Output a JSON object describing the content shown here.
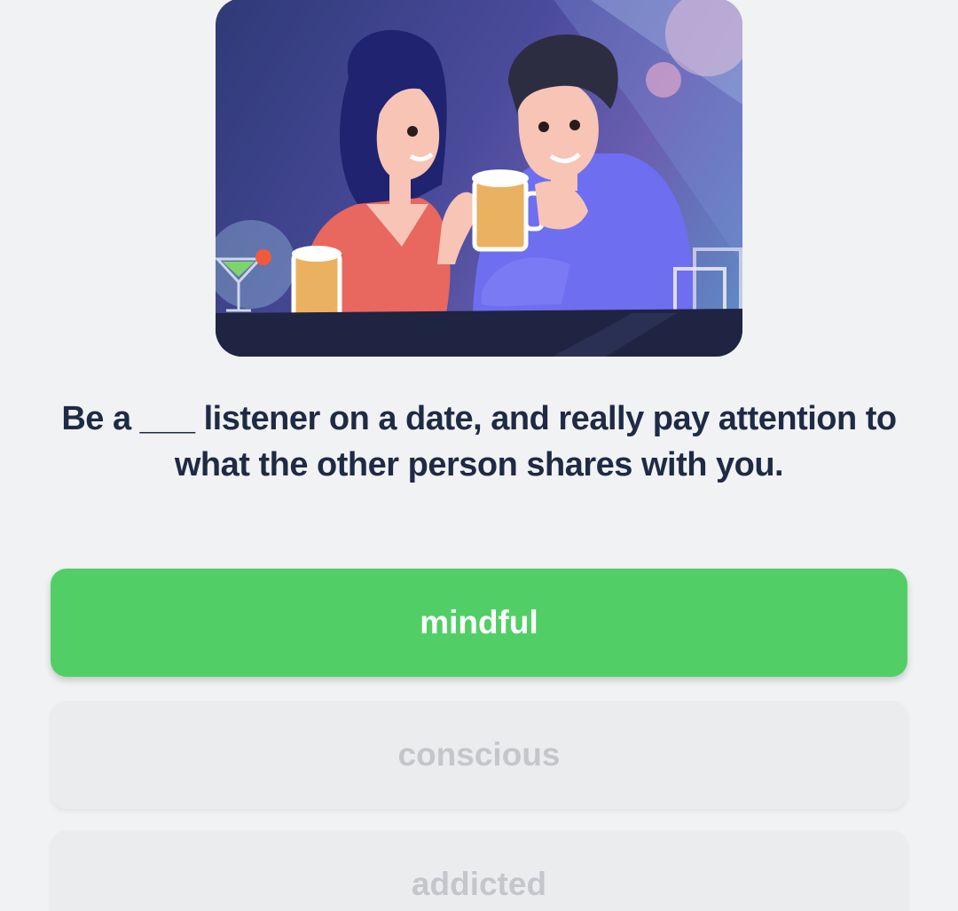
{
  "quiz": {
    "illustration": {
      "icon": "couple-at-bar-illustration"
    },
    "question": "Be a ___ listener on a date, and really pay attention to what the other person shares with you.",
    "options": [
      {
        "label": "mindful",
        "state": "correct"
      },
      {
        "label": "conscious",
        "state": "disabled"
      },
      {
        "label": "addicted",
        "state": "disabled"
      }
    ],
    "colors": {
      "correct": "#51cf66",
      "text": "#1f2a44",
      "muted_text": "#c4c6cb",
      "background": "#f1f2f4"
    }
  }
}
